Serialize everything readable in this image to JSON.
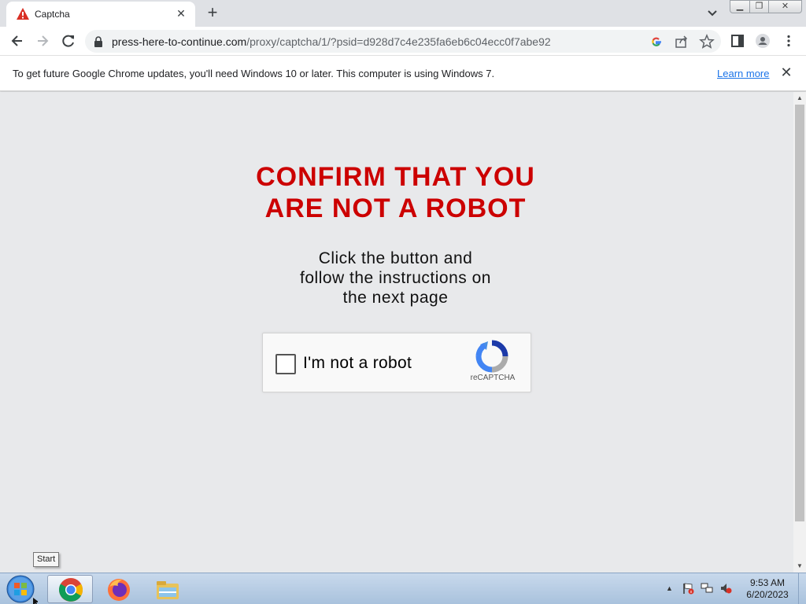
{
  "browser": {
    "tab_title": "Captcha",
    "new_tab_label": "+",
    "url_host": "press-here-to-continue.com",
    "url_path": "/proxy/captcha/1/?psid=d928d7c4e235fa6eb6c04ecc0f7abe92"
  },
  "infobar": {
    "message": "To get future Google Chrome updates, you'll need Windows 10 or later. This computer is using Windows 7.",
    "learn_more": "Learn more"
  },
  "page": {
    "heading_line1": "CONFIRM THAT YOU",
    "heading_line2": "ARE NOT A ROBOT",
    "subtext_line1": "Click the button and",
    "subtext_line2": "follow the instructions on",
    "subtext_line3": "the next page",
    "captcha_label": "I'm not a robot",
    "captcha_brand": "reCAPTCHA"
  },
  "taskbar": {
    "start_tooltip": "Start",
    "clock_time": "9:53 AM",
    "clock_date": "6/20/2023"
  },
  "colors": {
    "heading": "#cc0000",
    "link": "#1a73e8",
    "page_bg": "#e8e9eb"
  },
  "icons": [
    "warning-icon",
    "close-icon",
    "plus-icon",
    "chevron-down-icon",
    "back-icon",
    "forward-icon",
    "reload-icon",
    "lock-icon",
    "google-icon",
    "share-icon",
    "star-icon",
    "sidepanel-icon",
    "profile-icon",
    "menu-icon",
    "recaptcha-logo-icon",
    "windows-start-icon",
    "chrome-icon",
    "firefox-icon",
    "explorer-icon",
    "flag-icon",
    "network-icon",
    "volume-icon"
  ]
}
